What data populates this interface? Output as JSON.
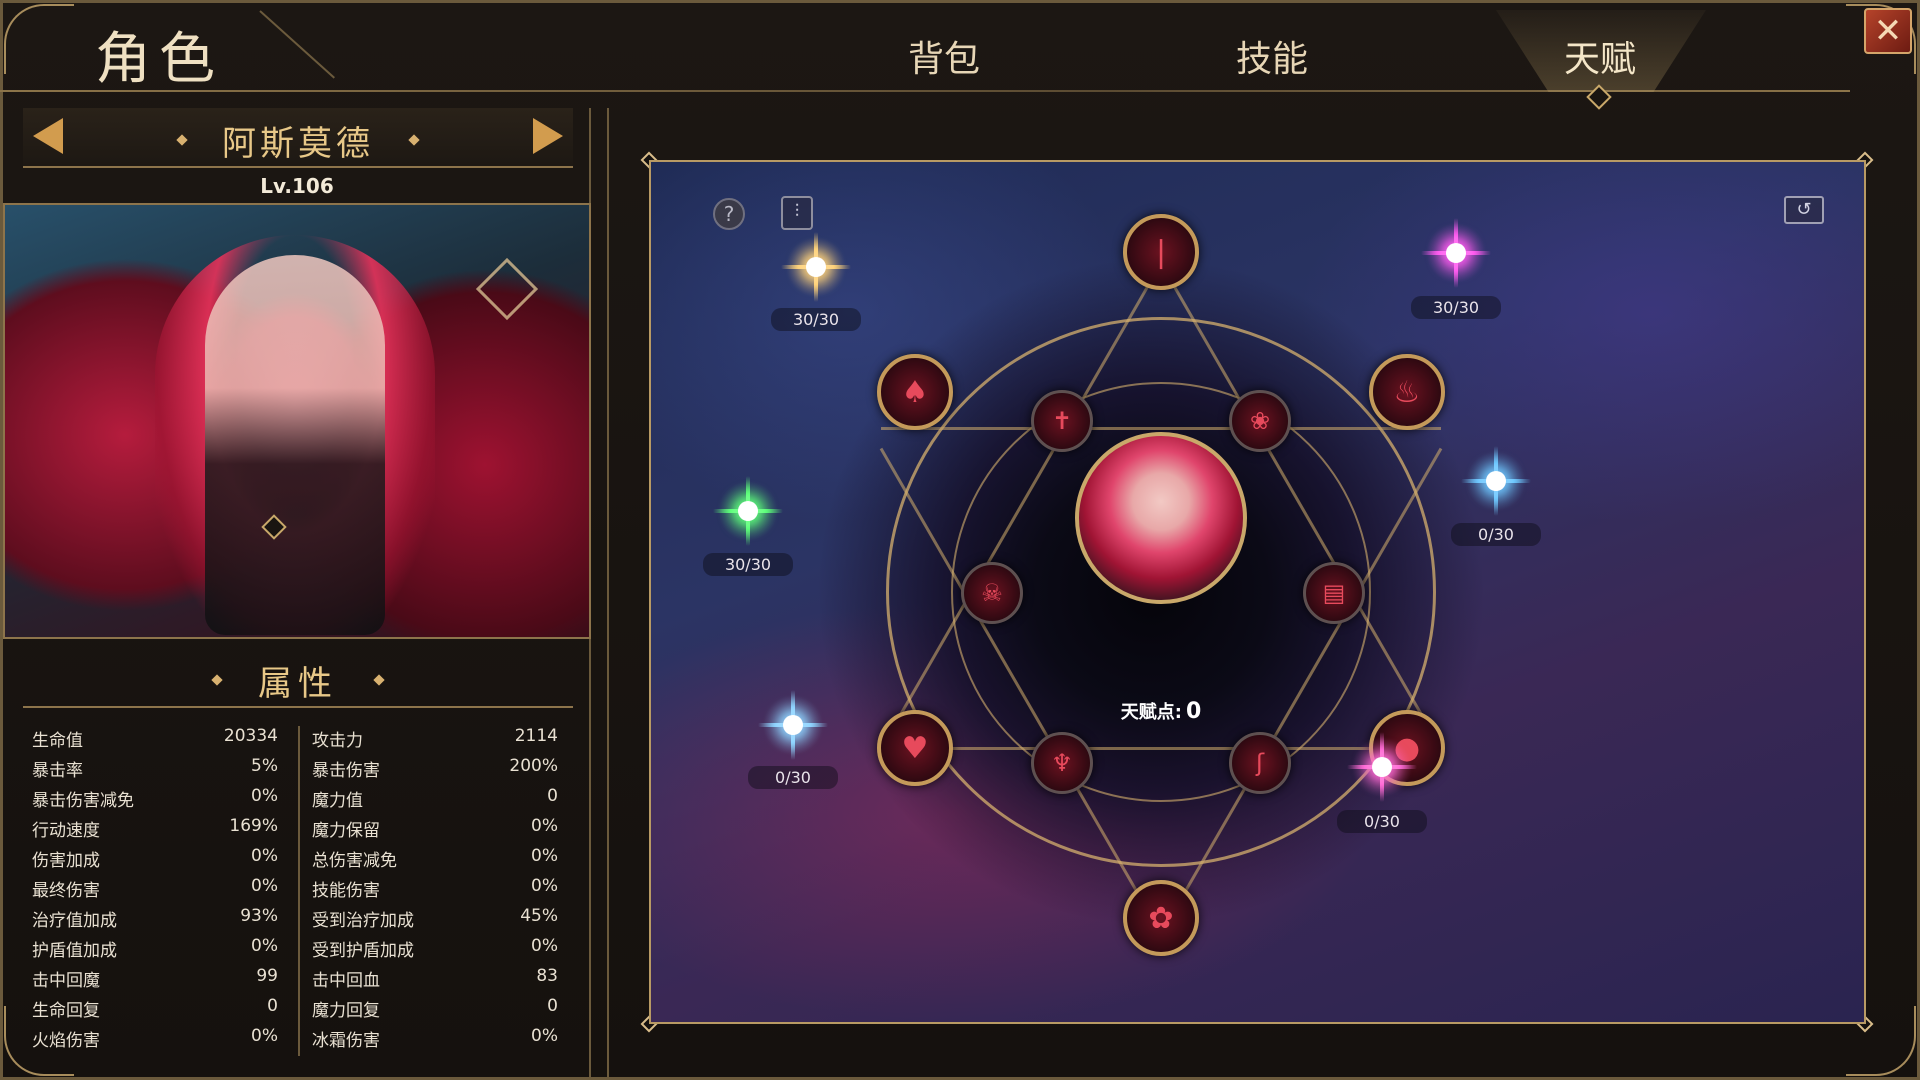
{
  "header": {
    "title": "角色",
    "tabs": [
      {
        "label": "背包"
      },
      {
        "label": "技能"
      },
      {
        "label": "天赋",
        "active": true
      }
    ]
  },
  "character": {
    "name": "阿斯莫德",
    "level": "Lv.106"
  },
  "attributes": {
    "title": "属性",
    "left": [
      {
        "label": "生命值",
        "value": "20334"
      },
      {
        "label": "暴击率",
        "value": "5%"
      },
      {
        "label": "暴击伤害减免",
        "value": "0%"
      },
      {
        "label": "行动速度",
        "value": "169%"
      },
      {
        "label": "伤害加成",
        "value": "0%"
      },
      {
        "label": "最终伤害",
        "value": "0%"
      },
      {
        "label": "治疗值加成",
        "value": "93%"
      },
      {
        "label": "护盾值加成",
        "value": "0%"
      },
      {
        "label": "击中回魔",
        "value": "99"
      },
      {
        "label": "生命回复",
        "value": "0"
      },
      {
        "label": "火焰伤害",
        "value": "0%"
      }
    ],
    "right": [
      {
        "label": "攻击力",
        "value": "2114"
      },
      {
        "label": "暴击伤害",
        "value": "200%"
      },
      {
        "label": "魔力值",
        "value": "0"
      },
      {
        "label": "魔力保留",
        "value": "0%"
      },
      {
        "label": "总伤害减免",
        "value": "0%"
      },
      {
        "label": "技能伤害",
        "value": "0%"
      },
      {
        "label": "受到治疗加成",
        "value": "45%"
      },
      {
        "label": "受到护盾加成",
        "value": "0%"
      },
      {
        "label": "击中回血",
        "value": "83"
      },
      {
        "label": "魔力回复",
        "value": "0"
      },
      {
        "label": "冰霜伤害",
        "value": "0%"
      }
    ]
  },
  "talent": {
    "points_label": "天赋点:",
    "points_value": "0",
    "stars": [
      {
        "progress": "30/30",
        "color": "#ffd27a"
      },
      {
        "progress": "30/30",
        "color": "#ff5cf0"
      },
      {
        "progress": "30/30",
        "color": "#5dff7a"
      },
      {
        "progress": "0/30",
        "color": "#6fc8ff"
      },
      {
        "progress": "0/30",
        "color": "#8fd4ff"
      },
      {
        "progress": "0/30",
        "color": "#ff6bd6"
      }
    ]
  },
  "icons": {
    "help": "?",
    "close": "✕",
    "reset": "↺",
    "filter": "⫶"
  }
}
